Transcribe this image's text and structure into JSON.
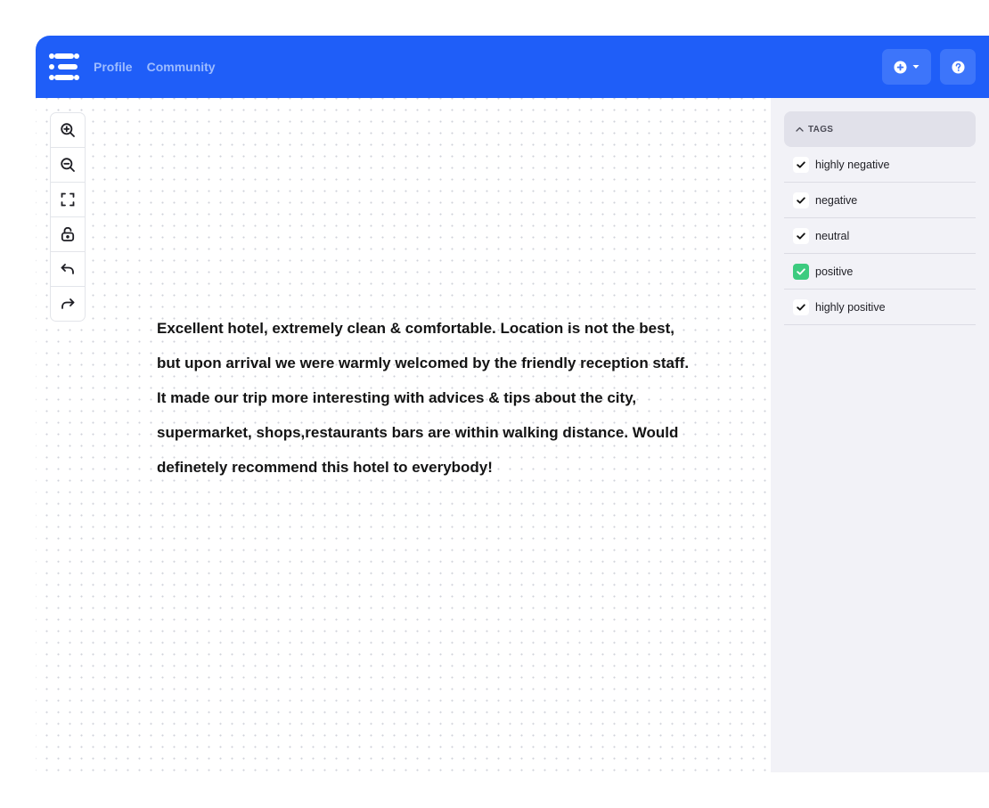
{
  "nav": {
    "links": [
      "Profile",
      "Community"
    ]
  },
  "icons": {
    "logo": "cluster-logo-icon",
    "add": "plus-circle-icon",
    "dropdown": "caret-down-icon",
    "help": "question-circle-icon",
    "tools": [
      "zoom-in-icon",
      "zoom-out-icon",
      "fit-screen-icon",
      "lock-open-icon",
      "undo-icon",
      "redo-icon"
    ]
  },
  "colors": {
    "brand": "#1f5ef8",
    "checked": "#3ccb7f",
    "sidebar_bg": "#f2f2f7"
  },
  "document": {
    "text": "Excellent hotel, extremely clean & comfortable. Location is not the best, but upon arrival we were warmly welcomed by the friendly reception staff. It made our trip more interesting with advices & tips about the city, supermarket, shops,restaurants bars are within walking distance. Would definetely recommend this hotel to everybody!"
  },
  "sidebar": {
    "tags_title": "TAGS",
    "tags": [
      {
        "label": "highly negative",
        "selected": false
      },
      {
        "label": "negative",
        "selected": false
      },
      {
        "label": "neutral",
        "selected": false
      },
      {
        "label": "positive",
        "selected": true
      },
      {
        "label": "highly positive",
        "selected": false
      }
    ]
  }
}
